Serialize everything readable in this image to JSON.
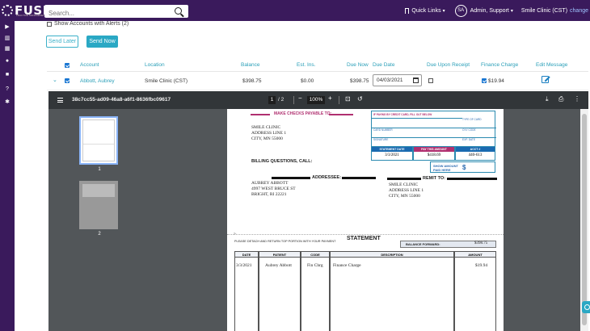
{
  "header": {
    "logo_text": "FUSE",
    "logo_sub": "PRACTICE MANAGEMENT",
    "search_placeholder": "Search...",
    "quick_links": "Quick Links",
    "avatar_initials": "SA",
    "user_name": "Admin, Support",
    "clinic": "Smile Clinic (CST)",
    "change": "change"
  },
  "sidebar": {
    "icons": [
      "play-icon",
      "chart-icon",
      "calendar-icon",
      "users-icon",
      "inbox-icon",
      "help-icon",
      "gear-icon"
    ]
  },
  "actions": {
    "show_alerts": "Show Accounts with Alerts (2)",
    "send_later": "Send Later",
    "send_now": "Send Now"
  },
  "table": {
    "headers": [
      "Account",
      "Location",
      "Balance",
      "Est. Ins.",
      "Due Now",
      "Due Date",
      "Due Upon Receipt",
      "Finance Charge",
      "Edit Message"
    ],
    "row": {
      "account": "Abbott, Aubrey",
      "location": "Smile Clinic (CST)",
      "balance": "$398.75",
      "est_ins": "$0.00",
      "due_now": "$398.75",
      "due_date": "04/03/2021",
      "finance_charge": "$19.94"
    }
  },
  "viewer": {
    "doc_id": "38c7cc55-ad09-46a8-a6f1-8636fbc09617",
    "page_current": "1",
    "page_total": "/  2",
    "zoom": "100%",
    "thumb_labels": [
      "1",
      "2"
    ]
  },
  "statement": {
    "make_checks": "MAKE CHECKS PAYABLE TO:",
    "payee_lines": [
      "SMILE CLINIC",
      "ADDRESS LINE 1",
      "CITY, MN 55000"
    ],
    "billing_q": "BILLING QUESTIONS, CALL:",
    "addressee_label": "ADDRESSEE:",
    "addressee_lines": [
      "AUBREY ABBOTT",
      "4997 WEST BRUCE ST",
      "BRIGHT, RI 22221"
    ],
    "remit_label": "REMIT TO:",
    "remit_lines": [
      "SMILE CLINIC",
      "ADDRESS LINE 1",
      "CITY, MN 55000"
    ],
    "card_note": "IF PAYING BY CREDIT CARD, FILL OUT BELOW",
    "card_type": "TYPE OF CARD",
    "card_number": "CARD NUMBER",
    "card_cvv": "CVV CODE",
    "signature": "SIGNATURE",
    "exp_date": "EXP. DATE",
    "stmt_date_head": "STATEMENT DATE",
    "stmt_date": "3/3/2021",
    "pay_amount_head": "PAY THIS AMOUNT",
    "pay_amount": "$418.69",
    "acct_head": "ACCT #",
    "acct": "440-613",
    "show_amount": "SHOW AMOUNT",
    "paid_here": "PAID HERE",
    "dollar": "$",
    "page_marker": "1-",
    "detach_text": "PLEASE DETACH AND RETURN TOP PORTION WITH YOUR PAYMENT",
    "statement_title": "STATEMENT",
    "balance_forward_label": "BALANCE FORWARD:",
    "balance_forward": "$398.75",
    "cols": [
      "DATE",
      "PATIENT",
      "CODE",
      "DESCRIPTION",
      "AMOUNT"
    ],
    "line": {
      "date": "3/3/2021",
      "patient": "Aubrey Abbott",
      "code": "Fin Chrg",
      "description": "Finance Charge",
      "amount": "$19.94"
    }
  }
}
